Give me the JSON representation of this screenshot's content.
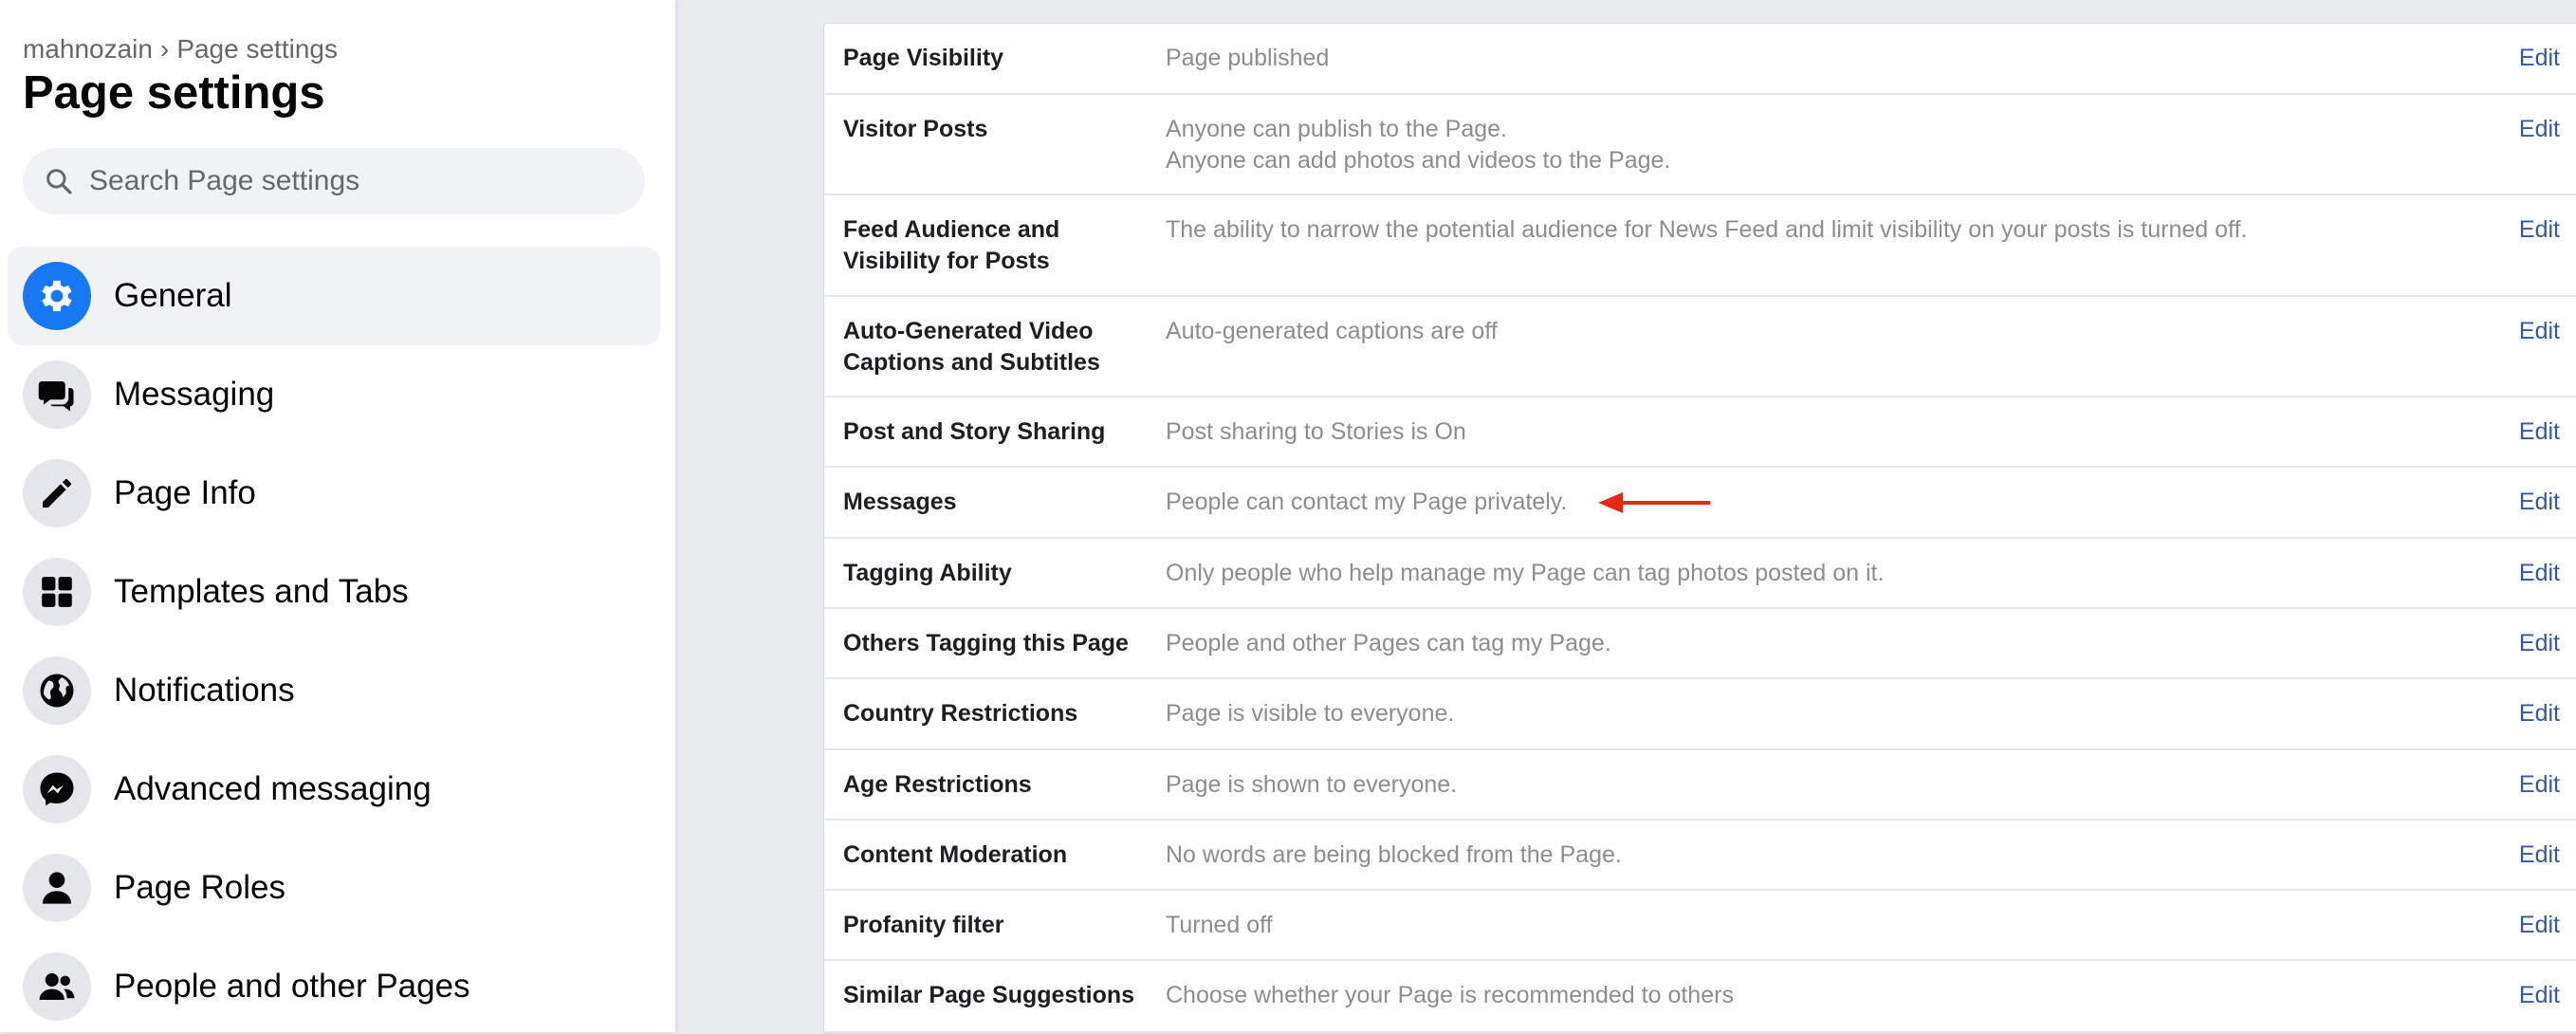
{
  "sidebar": {
    "breadcrumb": {
      "account": "mahnozain",
      "separator": "›",
      "current": "Page settings"
    },
    "title": "Page settings",
    "search": {
      "placeholder": "Search Page settings",
      "value": ""
    },
    "items": [
      {
        "label": "General",
        "icon": "gear-icon",
        "active": true
      },
      {
        "label": "Messaging",
        "icon": "chat-bubbles-icon",
        "active": false
      },
      {
        "label": "Page Info",
        "icon": "pencil-icon",
        "active": false
      },
      {
        "label": "Templates and Tabs",
        "icon": "grid-icon",
        "active": false
      },
      {
        "label": "Notifications",
        "icon": "globe-icon",
        "active": false
      },
      {
        "label": "Advanced messaging",
        "icon": "messenger-icon",
        "active": false
      },
      {
        "label": "Page Roles",
        "icon": "person-icon",
        "active": false
      },
      {
        "label": "People and other Pages",
        "icon": "people-icon",
        "active": false
      }
    ]
  },
  "settings": {
    "edit_label": "Edit",
    "rows": [
      {
        "title": "Page Visibility",
        "desc": [
          "Page published"
        ]
      },
      {
        "title": "Visitor Posts",
        "desc": [
          "Anyone can publish to the Page.",
          "Anyone can add photos and videos to the Page."
        ]
      },
      {
        "title": "Feed Audience and Visibility for Posts",
        "desc": [
          "The ability to narrow the potential audience for News Feed and limit visibility on your posts is turned off."
        ]
      },
      {
        "title": "Auto-Generated Video Captions and Subtitles",
        "desc": [
          "Auto-generated captions are off"
        ]
      },
      {
        "title": "Post and Story Sharing",
        "desc": [
          "Post sharing to Stories is On"
        ]
      },
      {
        "title": "Messages",
        "desc": [
          "People can contact my Page privately."
        ]
      },
      {
        "title": "Tagging Ability",
        "desc": [
          "Only people who help manage my Page can tag photos posted on it."
        ]
      },
      {
        "title": "Others Tagging this Page",
        "desc": [
          "People and other Pages can tag my Page."
        ]
      },
      {
        "title": "Country Restrictions",
        "desc": [
          "Page is visible to everyone."
        ]
      },
      {
        "title": "Age Restrictions",
        "desc": [
          "Page is shown to everyone."
        ]
      },
      {
        "title": "Content Moderation",
        "desc": [
          "No words are being blocked from the Page."
        ]
      },
      {
        "title": "Profanity filter",
        "desc": [
          "Turned off"
        ]
      },
      {
        "title": "Similar Page Suggestions",
        "desc": [
          "Choose whether your Page is recommended to others"
        ]
      }
    ]
  },
  "annotation": {
    "type": "red-arrow",
    "points_to": "Messages",
    "color": "#e42a14"
  },
  "colors": {
    "accent": "#1877f2",
    "link": "#385898",
    "muted_text": "#8a8d91"
  }
}
